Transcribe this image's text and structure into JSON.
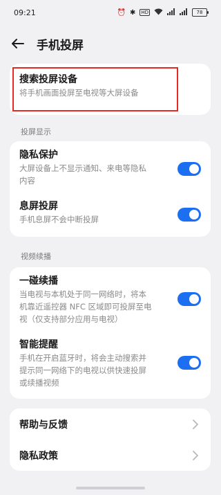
{
  "status_bar": {
    "time": "09:21",
    "battery": "78"
  },
  "header": {
    "title": "手机投屏"
  },
  "search_card": {
    "title": "搜索投屏设备",
    "subtitle": "将手机画面投屏至电视等大屏设备"
  },
  "section_display": {
    "label": "投屏显示",
    "items": [
      {
        "title": "隐私保护",
        "subtitle_line1": "大屏设备上不显示通知、来电等隐私",
        "subtitle_line2": "内容",
        "enabled": true
      },
      {
        "title": "息屏投屏",
        "subtitle_line1": "手机息屏不会中断投屏",
        "enabled": true
      }
    ]
  },
  "section_continue": {
    "label": "视频续播",
    "items": [
      {
        "title": "一碰续播",
        "subtitle_line1": "当电视与本机处于同一网络时，将本",
        "subtitle_line2": "机靠近遥控器 NFC 区域即可投屏至电",
        "subtitle_line3": "视（仅支持部分应用与电视）",
        "enabled": true
      },
      {
        "title": "智能提醒",
        "subtitle_line1": "手机在开启蓝牙时，将会主动搜索并",
        "subtitle_line2": "提示同一网络下的电视以供快速投屏",
        "subtitle_line3": "或续播视频",
        "enabled": true
      }
    ]
  },
  "links": [
    {
      "label": "帮助与反馈"
    },
    {
      "label": "隐私政策"
    }
  ],
  "colors": {
    "accent": "#1d6ff2",
    "highlight": "#e32b22"
  }
}
